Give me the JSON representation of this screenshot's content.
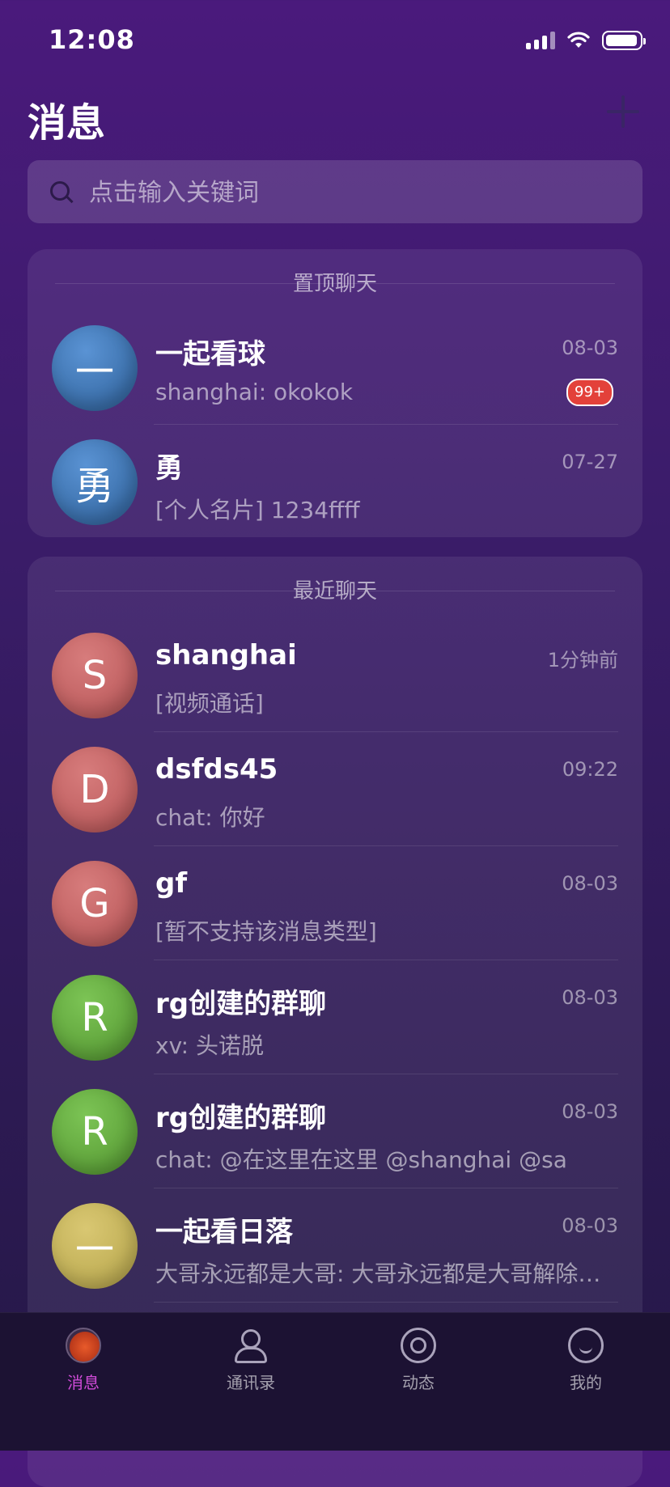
{
  "status_bar": {
    "time": "12:08"
  },
  "header": {
    "title": "消息",
    "add_icon": "plus-icon"
  },
  "search": {
    "placeholder": "点击输入关键词",
    "value": ""
  },
  "pinned": {
    "section_title": "置顶聊天",
    "chats": [
      {
        "avatar_text": "一",
        "avatar_color": "blue",
        "name": "一起看球",
        "time": "08-03",
        "preview": "shanghai: okokok",
        "badge": "99+"
      },
      {
        "avatar_text": "勇",
        "avatar_color": "blue",
        "name": "勇",
        "time": "07-27",
        "preview": "[个人名片] 1234ffff"
      }
    ]
  },
  "recent": {
    "section_title": "最近聊天",
    "chats": [
      {
        "avatar_text": "S",
        "avatar_color": "red",
        "name": "shanghai",
        "time": "1分钟前",
        "preview": "[视频通话]"
      },
      {
        "avatar_text": "D",
        "avatar_color": "red",
        "name": "dsfds45",
        "time": "09:22",
        "preview": "chat: 你好"
      },
      {
        "avatar_text": "G",
        "avatar_color": "red",
        "name": "gf",
        "time": "08-03",
        "preview": "[暂不支持该消息类型]"
      },
      {
        "avatar_text": "R",
        "avatar_color": "green",
        "name": "rg创建的群聊",
        "time": "08-03",
        "preview": "xv: 头诺脱"
      },
      {
        "avatar_text": "R",
        "avatar_color": "green",
        "name": "rg创建的群聊",
        "time": "08-03",
        "preview": "chat: @在这里在这里 @shanghai @sa"
      },
      {
        "avatar_text": "一",
        "avatar_color": "yellow",
        "name": "一起看日落",
        "time": "08-03",
        "preview": "大哥永远都是大哥: 大哥永远都是大哥解除…"
      }
    ]
  },
  "tabbar": {
    "tabs": [
      {
        "label": "消息",
        "icon": "message-icon",
        "active": true
      },
      {
        "label": "通讯录",
        "icon": "contacts-icon",
        "active": false
      },
      {
        "label": "动态",
        "icon": "moments-icon",
        "active": false
      },
      {
        "label": "我的",
        "icon": "profile-icon",
        "active": false
      }
    ]
  },
  "colors": {
    "accent": "#d04bd8",
    "badge": "#e3413a",
    "avatar_blue": "#3a6ea9",
    "avatar_red": "#bf5f60",
    "avatar_green": "#5ea23a",
    "avatar_yellow": "#bfae55"
  }
}
